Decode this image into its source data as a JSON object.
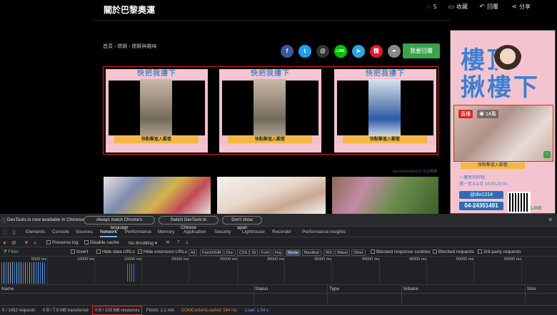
{
  "page": {
    "title": "關於巴黎奧運",
    "toolbar": {
      "comment_count": "5",
      "favorite_label": "收藏",
      "reply_label": "回覆",
      "share_label": "分享"
    },
    "breadcrumb": [
      "首頁",
      "閒聊",
      "閒聊與趣味"
    ],
    "reply_button": "我要回覆",
    "share_icons": [
      {
        "name": "facebook-icon",
        "glyph": "f",
        "color": "#3b5998"
      },
      {
        "name": "twitter-icon",
        "glyph": "t",
        "color": "#1da1f2"
      },
      {
        "name": "threads-icon",
        "glyph": "@",
        "color": "#333333"
      },
      {
        "name": "line-icon",
        "glyph": "LINE",
        "color": "#00c300"
      },
      {
        "name": "telegram-icon",
        "glyph": "➤",
        "color": "#2ca5e0"
      },
      {
        "name": "weibo-icon",
        "glyph": "微",
        "color": "#e6162d"
      },
      {
        "name": "link-icon",
        "glyph": "⚭",
        "color": "#888888"
      }
    ],
    "ads": [
      {
        "head": "快把我摟下",
        "button": "快點擊進入觀看"
      },
      {
        "head": "快把我摟下",
        "button": "快點擊進入觀看"
      },
      {
        "head": "快把我摟下",
        "button": "快點擊進入觀看"
      }
    ],
    "recommended": "Recommended by 全站推薦",
    "sidebar": {
      "title_line1": "樓頂",
      "title_line2": "揪樓下",
      "live": "直播",
      "viewers": "14萬",
      "button": "快點擊進入觀看",
      "info1": "一樓買到好物",
      "info2": "週一至五&日 14:00-23:00",
      "phone_id": "@dio1314",
      "phone": "04-24351491",
      "line": "LINE"
    }
  },
  "devtools": {
    "info_message": "DevTools is now available in Chinese!",
    "info_buttons": [
      "Always match Chrome's language",
      "Switch DevTools to Chinese",
      "Don't show again"
    ],
    "tabs": [
      "Elements",
      "Console",
      "Sources",
      "Network",
      "Performance",
      "Memory",
      "Application",
      "Security",
      "Lighthouse",
      "Recorder",
      "Performance insights"
    ],
    "active_tab": "Network",
    "tools": {
      "preserve_log": "Preserve log",
      "disable_cache": "Disable cache",
      "throttling": "No throttling"
    },
    "filter": {
      "placeholder": "Filter",
      "invert": "Invert",
      "hide_data_urls": "Hide data URLs",
      "hide_extension_urls": "Hide extension URLs",
      "types": [
        "All",
        "Fetch/XHR",
        "Doc",
        "CSS",
        "JS",
        "Font",
        "Img",
        "Media",
        "Manifest",
        "WS",
        "Wasm",
        "Other"
      ],
      "active_type": "Media",
      "blocked_cookies": "Blocked response cookies",
      "blocked_requests": "Blocked requests",
      "third_party": "3rd-party requests"
    },
    "timeline_labels": [
      "5000 ms",
      "10000 ms",
      "15000 ms",
      "20000 ms",
      "25000 ms",
      "30000 ms",
      "35000 ms",
      "40000 ms",
      "45000 ms",
      "50000 ms",
      "55000 ms"
    ],
    "columns": [
      "Name",
      "Status",
      "Type",
      "Initiator",
      "Size"
    ],
    "status": {
      "requests": "0 / 1452 requests",
      "transferred": "0 B / 7.5 MB transferred",
      "resources": "0 B / 103 MB resources",
      "finish": "Finish: 1.1 min",
      "dcl": "DOMContentLoaded: 584 ms",
      "load": "Load: 1.54 s"
    },
    "colors": {
      "accent": "#7cacf8",
      "dcl": "#e88a3c",
      "load": "#5aa8f0",
      "highlight": "#e0232b"
    }
  }
}
